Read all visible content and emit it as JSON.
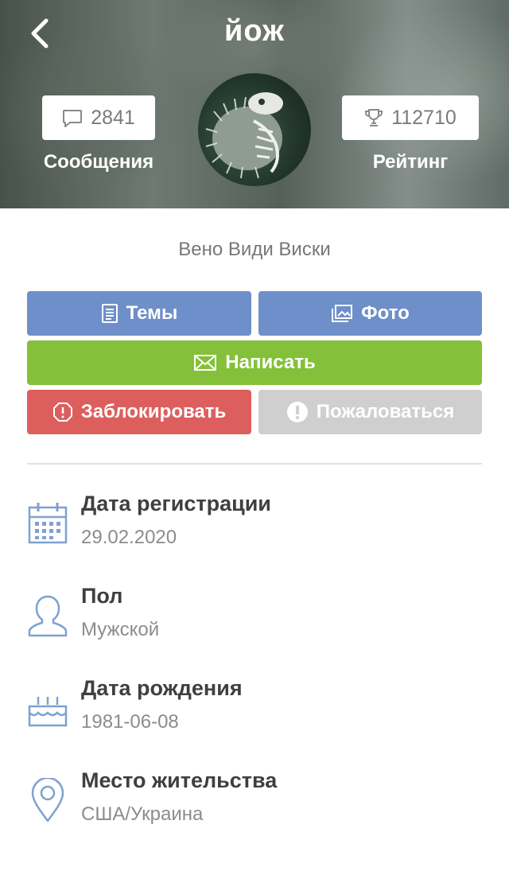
{
  "header": {
    "title": "йож",
    "messages": {
      "count": "2841",
      "label": "Сообщения"
    },
    "rating": {
      "count": "112710",
      "label": "Рейтинг"
    }
  },
  "profile": {
    "status": "Вено Види Виски"
  },
  "actions": {
    "topics": "Темы",
    "photo": "Фото",
    "write": "Написать",
    "block": "Заблокировать",
    "report": "Пожаловаться"
  },
  "info": {
    "registration": {
      "title": "Дата регистрации",
      "value": "29.02.2020"
    },
    "gender": {
      "title": "Пол",
      "value": "Мужской"
    },
    "birthday": {
      "title": "Дата рождения",
      "value": "1981-06-08"
    },
    "location": {
      "title": "Место жительства",
      "value": "США/Украина"
    }
  },
  "colors": {
    "primary_button": "#6e8fc9",
    "write_button": "#84c039",
    "block_button": "#dd5f5d",
    "report_button": "#cfcfcf",
    "info_icon": "#7fa1cf"
  },
  "icons": {
    "back": "chevron-left-icon",
    "messages": "speech-bubble-icon",
    "rating": "trophy-icon",
    "topics": "document-icon",
    "photo": "photos-icon",
    "write": "envelope-icon",
    "block": "block-octagon-icon",
    "report": "exclamation-circle-icon",
    "registration": "calendar-icon",
    "gender": "person-icon",
    "birthday": "birthday-cake-icon",
    "location": "map-pin-icon"
  }
}
